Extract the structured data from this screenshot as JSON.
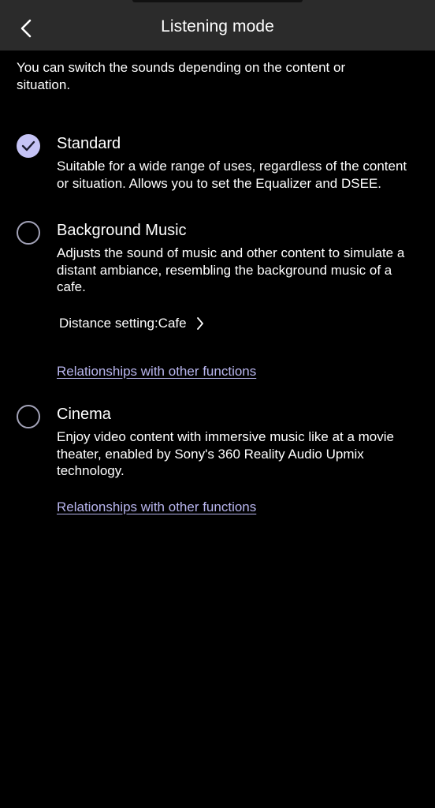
{
  "header": {
    "title": "Listening mode",
    "back_icon": "chevron-left-icon"
  },
  "intro_text": "You can switch the sounds depending on the content or situation.",
  "accent_color": "#c5c3f5",
  "link_color": "#b9b6ef",
  "options": [
    {
      "title": "Standard",
      "selected": true,
      "description": "Suitable for a wide range of uses, regardless of the content or situation. Allows you to set the Equalizer and DSEE."
    },
    {
      "title": "Background Music",
      "selected": false,
      "description": "Adjusts the sound of music and other content to simulate a distant ambiance, resembling the background music of a cafe.",
      "distance_setting": "Distance setting:Cafe",
      "link": "Relationships with other functions"
    },
    {
      "title": "Cinema",
      "selected": false,
      "description": "Enjoy video content with immersive music like at a movie theater, enabled by Sony's 360 Reality Audio Upmix technology.",
      "link": "Relationships with other functions"
    }
  ]
}
